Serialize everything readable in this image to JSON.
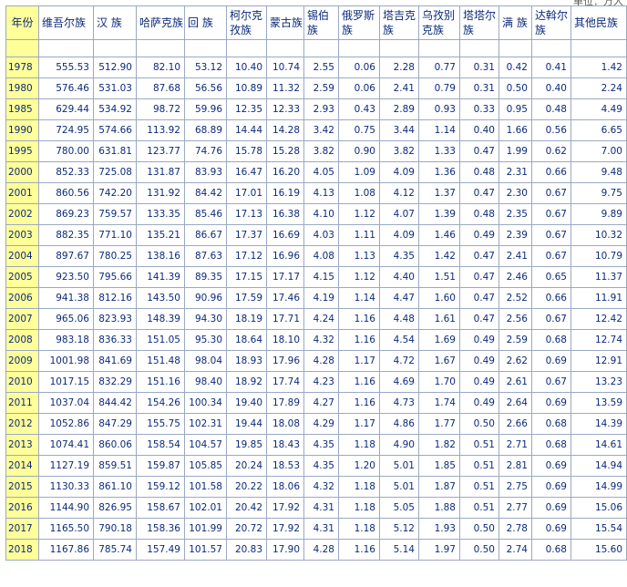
{
  "unit_text": "单位：万人",
  "columns": [
    "年份",
    "维吾尔族",
    "汉 族",
    "哈萨克族",
    "回 族",
    "柯尔克孜族",
    "蒙古族",
    "锡伯族",
    "俄罗斯族",
    "塔吉克族",
    "乌孜别克族",
    "塔塔尔族",
    "满 族",
    "达斡尔族",
    "其他民族"
  ],
  "rows": [
    [
      "1978",
      "555.53",
      "512.90",
      "82.10",
      "53.12",
      "10.40",
      "10.74",
      "2.55",
      "0.06",
      "2.28",
      "0.77",
      "0.31",
      "0.42",
      "0.41",
      "1.42"
    ],
    [
      "1980",
      "576.46",
      "531.03",
      "87.68",
      "56.56",
      "10.89",
      "11.32",
      "2.59",
      "0.06",
      "2.41",
      "0.79",
      "0.31",
      "0.50",
      "0.40",
      "2.24"
    ],
    [
      "1985",
      "629.44",
      "534.92",
      "98.72",
      "59.96",
      "12.35",
      "12.33",
      "2.93",
      "0.43",
      "2.89",
      "0.93",
      "0.33",
      "0.95",
      "0.48",
      "4.49"
    ],
    [
      "1990",
      "724.95",
      "574.66",
      "113.92",
      "68.89",
      "14.44",
      "14.28",
      "3.42",
      "0.75",
      "3.44",
      "1.14",
      "0.40",
      "1.66",
      "0.56",
      "6.65"
    ],
    [
      "1995",
      "780.00",
      "631.81",
      "123.77",
      "74.76",
      "15.78",
      "15.28",
      "3.82",
      "0.90",
      "3.82",
      "1.33",
      "0.47",
      "1.99",
      "0.62",
      "7.00"
    ],
    [
      "2000",
      "852.33",
      "725.08",
      "131.87",
      "83.93",
      "16.47",
      "16.20",
      "4.05",
      "1.09",
      "4.09",
      "1.36",
      "0.48",
      "2.31",
      "0.66",
      "9.48"
    ],
    [
      "2001",
      "860.56",
      "742.20",
      "131.92",
      "84.42",
      "17.01",
      "16.19",
      "4.13",
      "1.08",
      "4.12",
      "1.37",
      "0.47",
      "2.30",
      "0.67",
      "9.75"
    ],
    [
      "2002",
      "869.23",
      "759.57",
      "133.35",
      "85.46",
      "17.13",
      "16.38",
      "4.10",
      "1.12",
      "4.07",
      "1.39",
      "0.48",
      "2.35",
      "0.67",
      "9.89"
    ],
    [
      "2003",
      "882.35",
      "771.10",
      "135.21",
      "86.67",
      "17.37",
      "16.69",
      "4.03",
      "1.11",
      "4.09",
      "1.46",
      "0.49",
      "2.39",
      "0.67",
      "10.32"
    ],
    [
      "2004",
      "897.67",
      "780.25",
      "138.16",
      "87.63",
      "17.12",
      "16.96",
      "4.08",
      "1.13",
      "4.35",
      "1.42",
      "0.47",
      "2.41",
      "0.67",
      "10.79"
    ],
    [
      "2005",
      "923.50",
      "795.66",
      "141.39",
      "89.35",
      "17.15",
      "17.17",
      "4.15",
      "1.12",
      "4.40",
      "1.51",
      "0.47",
      "2.46",
      "0.65",
      "11.37"
    ],
    [
      "2006",
      "941.38",
      "812.16",
      "143.50",
      "90.96",
      "17.59",
      "17.46",
      "4.19",
      "1.14",
      "4.47",
      "1.60",
      "0.47",
      "2.52",
      "0.66",
      "11.91"
    ],
    [
      "2007",
      "965.06",
      "823.93",
      "148.39",
      "94.30",
      "18.19",
      "17.71",
      "4.24",
      "1.16",
      "4.48",
      "1.61",
      "0.47",
      "2.56",
      "0.67",
      "12.42"
    ],
    [
      "2008",
      "983.18",
      "836.33",
      "151.05",
      "95.30",
      "18.64",
      "18.10",
      "4.32",
      "1.16",
      "4.54",
      "1.69",
      "0.49",
      "2.59",
      "0.68",
      "12.74"
    ],
    [
      "2009",
      "1001.98",
      "841.69",
      "151.48",
      "98.04",
      "18.93",
      "17.96",
      "4.28",
      "1.17",
      "4.72",
      "1.67",
      "0.49",
      "2.62",
      "0.69",
      "12.91"
    ],
    [
      "2010",
      "1017.15",
      "832.29",
      "151.16",
      "98.40",
      "18.92",
      "17.74",
      "4.23",
      "1.16",
      "4.69",
      "1.70",
      "0.49",
      "2.61",
      "0.67",
      "13.23"
    ],
    [
      "2011",
      "1037.04",
      "844.42",
      "154.26",
      "100.34",
      "19.40",
      "17.89",
      "4.27",
      "1.16",
      "4.73",
      "1.74",
      "0.49",
      "2.64",
      "0.69",
      "13.59"
    ],
    [
      "2012",
      "1052.86",
      "847.29",
      "155.75",
      "102.31",
      "19.44",
      "18.08",
      "4.29",
      "1.17",
      "4.86",
      "1.77",
      "0.50",
      "2.66",
      "0.68",
      "14.39"
    ],
    [
      "2013",
      "1074.41",
      "860.06",
      "158.54",
      "104.57",
      "19.85",
      "18.43",
      "4.35",
      "1.18",
      "4.90",
      "1.82",
      "0.51",
      "2.71",
      "0.68",
      "14.61"
    ],
    [
      "2014",
      "1127.19",
      "859.51",
      "159.87",
      "105.85",
      "20.24",
      "18.53",
      "4.35",
      "1.20",
      "5.01",
      "1.85",
      "0.51",
      "2.81",
      "0.69",
      "14.94"
    ],
    [
      "2015",
      "1130.33",
      "861.10",
      "159.12",
      "101.58",
      "20.22",
      "18.06",
      "4.32",
      "1.18",
      "5.01",
      "1.87",
      "0.51",
      "2.75",
      "0.69",
      "14.99"
    ],
    [
      "2016",
      "1144.90",
      "826.95",
      "158.67",
      "102.01",
      "20.42",
      "17.92",
      "4.31",
      "1.18",
      "5.05",
      "1.88",
      "0.51",
      "2.77",
      "0.69",
      "15.06"
    ],
    [
      "2017",
      "1165.50",
      "790.18",
      "158.36",
      "101.99",
      "20.72",
      "17.92",
      "4.31",
      "1.18",
      "5.12",
      "1.93",
      "0.50",
      "2.78",
      "0.69",
      "15.54"
    ],
    [
      "2018",
      "1167.86",
      "785.74",
      "157.49",
      "101.57",
      "20.83",
      "17.90",
      "4.28",
      "1.16",
      "5.14",
      "1.97",
      "0.50",
      "2.74",
      "0.68",
      "15.60"
    ]
  ]
}
